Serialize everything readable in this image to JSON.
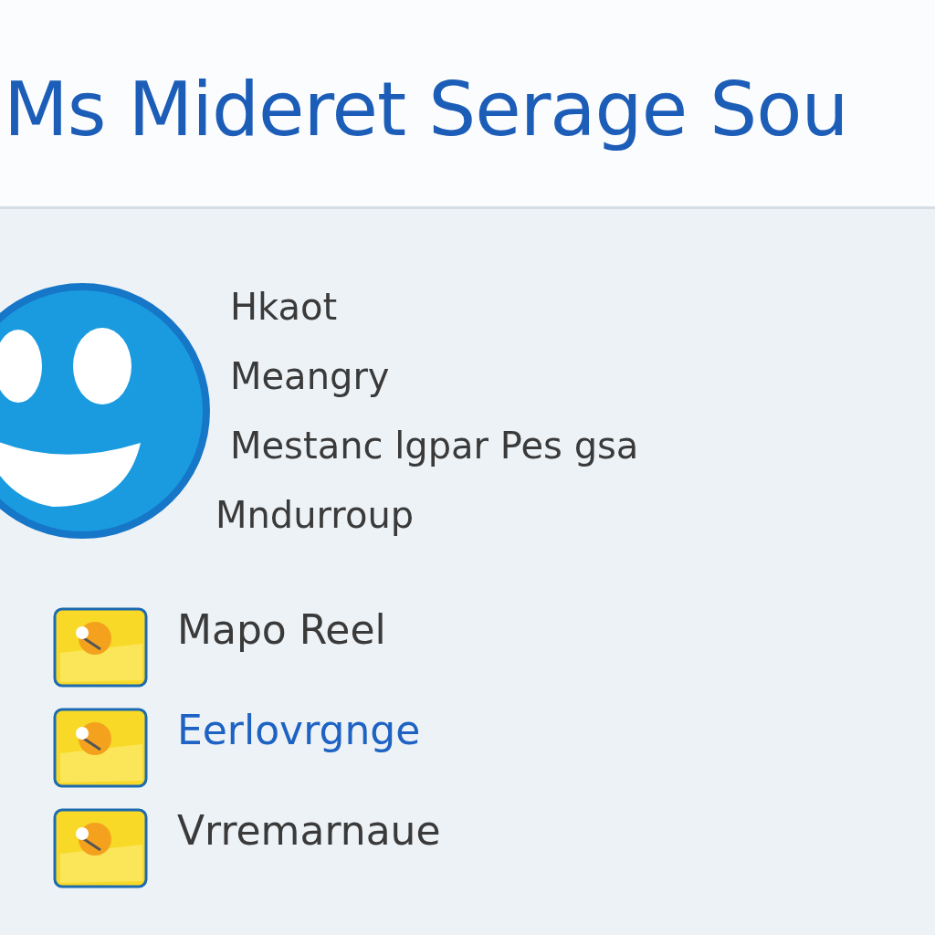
{
  "header": {
    "title": "Ms Mideret Serage Sou"
  },
  "profile": {
    "lines": [
      "Hkaot",
      "Meangry",
      "Mestanc lgpar Pes gsa",
      "Mndurroup"
    ]
  },
  "apps": [
    {
      "label": "Mapo Reel",
      "selected": false
    },
    {
      "label": "Eerlovrgnge",
      "selected": true
    },
    {
      "label": "Vrremarnaue",
      "selected": false
    }
  ]
}
